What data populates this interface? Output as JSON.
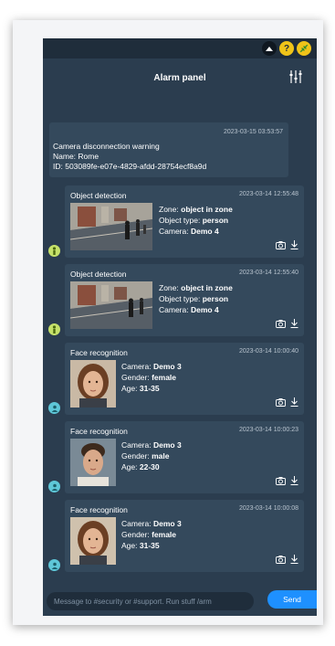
{
  "topbar": {
    "icons": [
      "chevron-up-icon",
      "help-icon",
      "plug-icon"
    ],
    "help_glyph": "?"
  },
  "header": {
    "title": "Alarm panel",
    "settings_icon": "sliders-icon"
  },
  "warning": {
    "timestamp": "2023-03-15 03:53:57",
    "title": "Camera disconnection warning",
    "name_line": "Name: Rome",
    "id_line": "ID: 503089fe-e07e-4829-afdd-28754ecf8a9d"
  },
  "alerts": [
    {
      "type": "Object detection",
      "timestamp": "2023-03-14 12:55:48",
      "zone_label": "Zone:",
      "zone_value": "object in zone",
      "object_label": "Object type:",
      "object_value": "person",
      "camera_label": "Camera:",
      "camera_value": "Demo 4"
    },
    {
      "type": "Object detection",
      "timestamp": "2023-03-14 12:55:40",
      "zone_label": "Zone:",
      "zone_value": "object in zone",
      "object_label": "Object type:",
      "object_value": "person",
      "camera_label": "Camera:",
      "camera_value": "Demo 4"
    },
    {
      "type": "Face recognition",
      "timestamp": "2023-03-14 10:00:40",
      "camera_label": "Camera:",
      "camera_value": "Demo 3",
      "gender_label": "Gender:",
      "gender_value": "female",
      "age_label": "Age:",
      "age_value": "31-35"
    },
    {
      "type": "Face recognition",
      "timestamp": "2023-03-14 10:00:23",
      "camera_label": "Camera:",
      "camera_value": "Demo 3",
      "gender_label": "Gender:",
      "gender_value": "male",
      "age_label": "Age:",
      "age_value": "22-30"
    },
    {
      "type": "Face recognition",
      "timestamp": "2023-03-14 10:00:08",
      "camera_label": "Camera:",
      "camera_value": "Demo 3",
      "gender_label": "Gender:",
      "gender_value": "female",
      "age_label": "Age:",
      "age_value": "31-35"
    }
  ],
  "composer": {
    "placeholder": "Message to #security or #support. Run stuff /arm",
    "send_label": "Send"
  },
  "colors": {
    "panel_bg": "#2b3d4f",
    "card_bg": "#34495c",
    "accent_blue": "#1e90ff",
    "object_badge": "#c6e26a",
    "face_badge": "#5ec7d8",
    "status_yellow": "#f0c419"
  }
}
